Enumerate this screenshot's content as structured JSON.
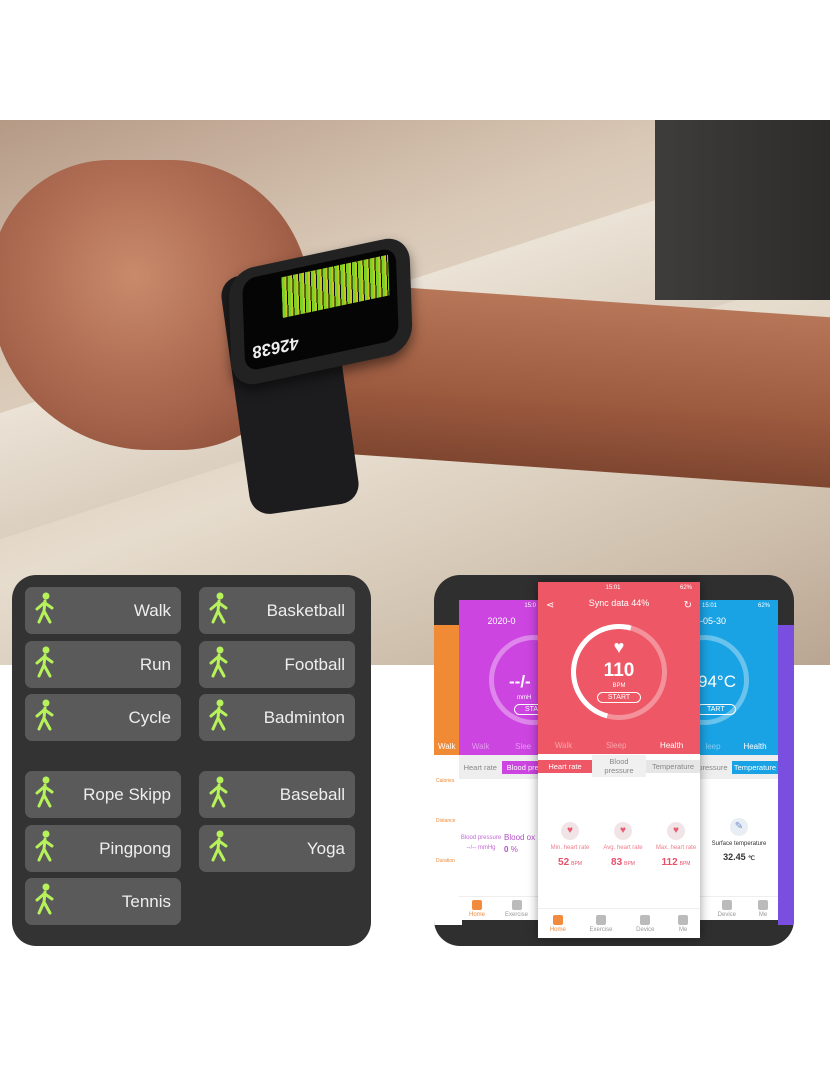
{
  "watch": {
    "steps": "42638"
  },
  "sports": [
    {
      "label": "Walk",
      "icon": "walk-icon"
    },
    {
      "label": "Basketball",
      "icon": "basketball-icon"
    },
    {
      "label": "Run",
      "icon": "run-icon"
    },
    {
      "label": "Football",
      "icon": "football-icon"
    },
    {
      "label": "Cycle",
      "icon": "cycle-icon"
    },
    {
      "label": "Badminton",
      "icon": "badminton-icon"
    },
    {
      "label": "Rope Skipp",
      "icon": "rope-skipping-icon"
    },
    {
      "label": "Baseball",
      "icon": "baseball-icon"
    },
    {
      "label": "Pingpong",
      "icon": "pingpong-icon"
    },
    {
      "label": "Yoga",
      "icon": "yoga-icon"
    },
    {
      "label": "Tennis",
      "icon": "tennis-icon"
    }
  ],
  "colors": {
    "accent_green": "#b6f25a",
    "heart": "#ee5866",
    "purple": "#cc45e0",
    "blue": "#1aa3e4",
    "orange": "#f08a35"
  },
  "phone_orange": {
    "tab": "Walk",
    "items": [
      "Calories",
      "Distance",
      "Duration"
    ],
    "nav": "Home"
  },
  "phone_purple": {
    "time": "15:0",
    "date": "2020-0",
    "value": "--/-",
    "unit": "mmH",
    "start": "STAR",
    "tabs": [
      "Walk",
      "Slee"
    ],
    "subtabs": [
      "Heart rate",
      "Blood pre"
    ],
    "stats": [
      {
        "label": "Blood pressure",
        "value": "--/--",
        "unit": "mmHg"
      },
      {
        "label": "Blood ox",
        "value": "0",
        "unit": "%"
      }
    ],
    "nav": [
      "Home",
      "Exercise"
    ]
  },
  "phone_center": {
    "time": "15:01",
    "battery": "62%",
    "title": "Sync data 44%",
    "value": "110",
    "unit": "BPM",
    "start": "START",
    "tabs": [
      "Walk",
      "Sleep",
      "Health"
    ],
    "subtabs": [
      "Heart rate",
      "Blood pressure",
      "Temperature"
    ],
    "stats": [
      {
        "label": "Min. heart rate",
        "value": "52",
        "unit": "BPM"
      },
      {
        "label": "Avg. heart rate",
        "value": "83",
        "unit": "BPM"
      },
      {
        "label": "Max. heart rate",
        "value": "112",
        "unit": "BPM"
      }
    ],
    "nav": [
      "Home",
      "Exercise",
      "Device",
      "Me"
    ]
  },
  "phone_blue": {
    "time": "15:01",
    "battery": "62%",
    "date": "-05-30",
    "value": "94°C",
    "start": "TART",
    "tabs": [
      "leep",
      "Health"
    ],
    "subtabs": [
      "pressure",
      "Temperature"
    ],
    "stat": {
      "label": "Surface temperature",
      "value": "32.45",
      "unit": "℃"
    },
    "nav": [
      "Device",
      "Me"
    ]
  }
}
